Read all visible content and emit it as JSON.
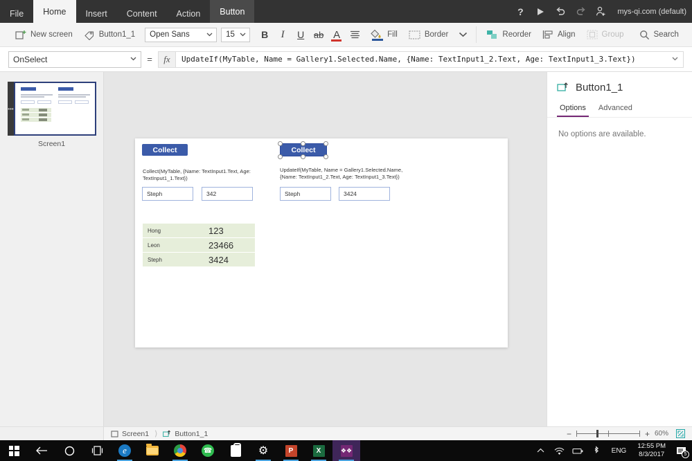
{
  "titlebar": {
    "tabs": [
      {
        "label": "File",
        "state": "normal"
      },
      {
        "label": "Home",
        "state": "active"
      },
      {
        "label": "Insert",
        "state": "normal"
      },
      {
        "label": "Content",
        "state": "normal"
      },
      {
        "label": "Action",
        "state": "normal"
      },
      {
        "label": "Button",
        "state": "contextual"
      }
    ],
    "help_icon": "help-icon",
    "play_icon": "play-icon",
    "undo_icon": "undo-icon",
    "redo_icon": "redo-icon",
    "account_icon": "account-add-icon",
    "environment": "mys-qi.com (default)"
  },
  "ribbon": {
    "new_screen": "New screen",
    "control_name": "Button1_1",
    "font_family": "Open Sans",
    "font_size": "15",
    "bold": "B",
    "italic": "I",
    "underline": "U",
    "strikethrough": "ab",
    "font_color": "A",
    "align": "align-icon",
    "fill": "Fill",
    "border": "Border",
    "border_more": "chevron-down-icon",
    "reorder": "Reorder",
    "align_label": "Align",
    "group": "Group",
    "search": "Search"
  },
  "formulabar": {
    "property": "OnSelect",
    "equals": "=",
    "fx": "fx",
    "formula": "UpdateIf(MyTable, Name = Gallery1.Selected.Name, {Name: TextInput1_2.Text, Age: TextInput1_3.Text})"
  },
  "screenpane": {
    "screen_label": "Screen1",
    "overflow_menu": "•••"
  },
  "canvas": {
    "button_left": {
      "label": "Collect"
    },
    "button_right": {
      "label": "Collect",
      "selected": true
    },
    "label_left": "Collect(MyTable, {Name: TextInput1.Text, Age: TextInput1_1.Text})",
    "label_right": "UpdateIf(MyTable, Name = Gallery1.Selected.Name, {Name: TextInput1_2.Text, Age: TextInput1_3.Text})",
    "inputs": [
      {
        "name": "TextInput1",
        "value": "Steph"
      },
      {
        "name": "TextInput1_1",
        "value": "342"
      },
      {
        "name": "TextInput1_2",
        "value": "Steph"
      },
      {
        "name": "TextInput1_3",
        "value": "3424"
      }
    ],
    "gallery": {
      "rows": [
        {
          "name": "Hong",
          "age": "123"
        },
        {
          "name": "Leon",
          "age": "23466"
        },
        {
          "name": "Steph",
          "age": "3424"
        }
      ]
    },
    "colors": {
      "button_fill": "#3b5ba9",
      "gallery_row": "#e6eeda",
      "selection": "#2d4b9e"
    }
  },
  "proppane": {
    "icon": "button-control-icon",
    "title": "Button1_1",
    "tabs": [
      {
        "label": "Options",
        "active": true
      },
      {
        "label": "Advanced",
        "active": false
      }
    ],
    "empty_message": "No options are available."
  },
  "statusbar": {
    "breadcrumb": [
      {
        "label": "Screen1",
        "icon": "screen-icon"
      },
      {
        "label": "Button1_1",
        "icon": "button-control-icon"
      }
    ],
    "zoom_minus": "−",
    "zoom_plus": "+",
    "zoom_level": "60%",
    "fit_icon": "fit-to-screen-icon"
  },
  "taskbar": {
    "items": [
      {
        "icon": "windows-start-icon",
        "name": "start-button"
      },
      {
        "icon": "back-arrow-icon",
        "name": "back-button"
      },
      {
        "icon": "cortana-circle-icon",
        "name": "cortana-button"
      },
      {
        "icon": "task-view-icon",
        "name": "task-view-button"
      },
      {
        "icon": "edge-icon",
        "name": "edge-app",
        "running": true
      },
      {
        "icon": "file-explorer-icon",
        "name": "file-explorer-app",
        "running": false
      },
      {
        "icon": "chrome-icon",
        "name": "chrome-app",
        "running": true
      },
      {
        "icon": "whatsapp-icon",
        "name": "whatsapp-app",
        "running": false
      },
      {
        "icon": "store-icon",
        "name": "store-app",
        "running": false
      },
      {
        "icon": "settings-gear-icon",
        "name": "settings-app",
        "running": true
      },
      {
        "icon": "powerpoint-icon",
        "name": "powerpoint-app",
        "running": true
      },
      {
        "icon": "excel-icon",
        "name": "excel-app",
        "running": true
      },
      {
        "icon": "powerapps-icon",
        "name": "powerapps-app",
        "running": true,
        "active": true
      }
    ],
    "tray": {
      "show_hidden": "chevron-up-icon",
      "wifi": "wifi-icon",
      "battery": "battery-icon",
      "bluetooth": "bluetooth-icon",
      "language": "ENG",
      "time": "12:55 PM",
      "date": "8/3/2017",
      "notifications_count": "5"
    }
  }
}
